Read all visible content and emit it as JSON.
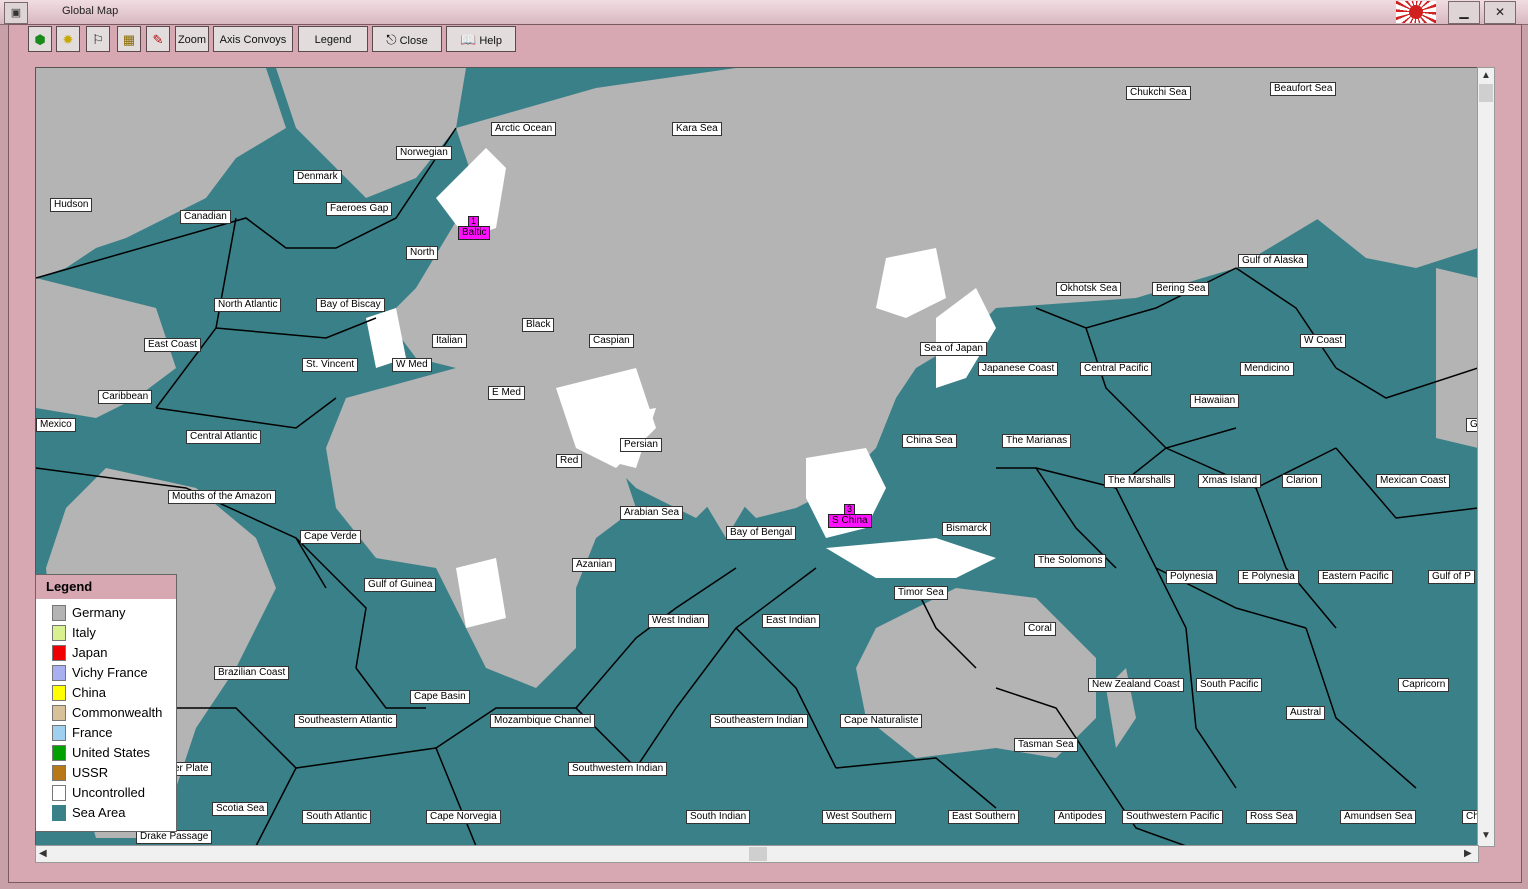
{
  "window": {
    "title": "Global Map"
  },
  "toolbar": {
    "zoom_label": "Zoom",
    "axis_convoys_label": "Axis Convoys",
    "legend_label": "Legend",
    "close_label": "Close",
    "help_label": "Help"
  },
  "legend": {
    "title": "Legend",
    "items": [
      {
        "label": "Germany",
        "color": "#b4b4b4"
      },
      {
        "label": "Italy",
        "color": "#d8f090"
      },
      {
        "label": "Japan",
        "color": "#f00000"
      },
      {
        "label": "Vichy France",
        "color": "#a8b0f0"
      },
      {
        "label": "China",
        "color": "#ffff00"
      },
      {
        "label": "Commonwealth",
        "color": "#d8c098"
      },
      {
        "label": "France",
        "color": "#a0d0f0"
      },
      {
        "label": "United States",
        "color": "#00a000"
      },
      {
        "label": "USSR",
        "color": "#b87818"
      },
      {
        "label": "Uncontrolled",
        "color": "#ffffff"
      },
      {
        "label": "Sea Area",
        "color": "#3a8088"
      }
    ]
  },
  "fleets": [
    {
      "label": "Baltic",
      "count": "1"
    },
    {
      "label": "S China",
      "count": "3"
    }
  ],
  "sea_areas": [
    "Arctic Ocean",
    "Kara Sea",
    "Chukchi Sea",
    "Beaufort Sea",
    "Norwegian",
    "Denmark",
    "Hudson",
    "Canadian",
    "Faeroes Gap",
    "North",
    "Gulf of Alaska",
    "Okhotsk Sea",
    "Bering Sea",
    "North Atlantic",
    "Bay of Biscay",
    "Black",
    "Caspian",
    "Sea of Japan",
    "W Coast",
    "East Coast",
    "Italian",
    "St. Vincent",
    "W Med",
    "Japanese Coast",
    "Central Pacific",
    "Mendicino",
    "Caribbean",
    "E Med",
    "Hawaiian",
    "Mexico",
    "Central Atlantic",
    "Persian",
    "China Sea",
    "The Marianas",
    "Red",
    "The Marshalls",
    "Xmas Island",
    "Clarion",
    "Mexican Coast",
    "Mouths of the Amazon",
    "Arabian Sea",
    "Bismarck",
    "Cape Verde",
    "Bay of Bengal",
    "The Solomons",
    "Azanian",
    "Polynesia",
    "E Polynesia",
    "Eastern Pacific",
    "Gulf of P",
    "Gulf of Guinea",
    "Timor Sea",
    "West Indian",
    "East Indian",
    "Coral",
    "Brazilian Coast",
    "New Zealand Coast",
    "South Pacific",
    "Capricorn",
    "Cape Basin",
    "Southeastern Atlantic",
    "Mozambique Channel",
    "Southeastern Indian",
    "Cape Naturaliste",
    "Austral",
    "Tasman Sea",
    "er Plate",
    "Southwestern Indian",
    "Scotia Sea",
    "South Atlantic",
    "Cape Norvegia",
    "South Indian",
    "West Southern",
    "East Southern",
    "Antipodes",
    "Southwestern Pacific",
    "Ross Sea",
    "Amundsen Sea",
    "Drake Passage",
    "Ch",
    "G"
  ]
}
